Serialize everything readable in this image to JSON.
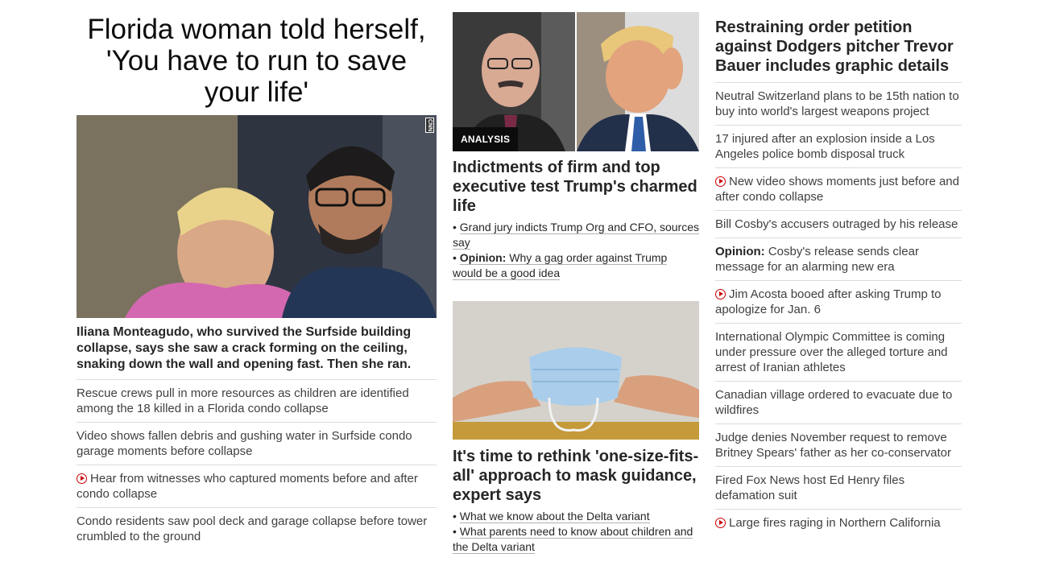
{
  "lead": {
    "headline": "Florida woman told herself, 'You have to run to save your life'",
    "image_badge": "CNN",
    "caption": "Iliana Monteagudo, who survived the Surfside building collapse, says she saw a crack forming on the ceiling, snaking down the wall and opening fast. Then she ran.",
    "related": [
      {
        "text": "Rescue crews pull in more resources as children are identified among the 18 killed in a Florida condo collapse",
        "video": false
      },
      {
        "text": "Video shows fallen debris and gushing water in Surfside condo garage moments before collapse",
        "video": false
      },
      {
        "text": "Hear from witnesses who captured moments before and after condo collapse",
        "video": true
      },
      {
        "text": "Condo residents saw pool deck and garage collapse before tower crumbled to the ground",
        "video": false
      }
    ]
  },
  "middle": {
    "story1": {
      "tag": "ANALYSIS",
      "title": "Indictments of firm and top executive test Trump's charmed life",
      "links": [
        {
          "label": "",
          "text": "Grand jury indicts Trump Org and CFO, sources say"
        },
        {
          "label": "Opinion:",
          "text": "Why a gag order against Trump would be a good idea"
        }
      ]
    },
    "story2": {
      "title": "It's time to rethink 'one-size-fits-all' approach to mask guidance, expert says",
      "links": [
        {
          "label": "",
          "text": "What we know about the Delta variant"
        },
        {
          "label": "",
          "text": "What parents need to know about children and the Delta variant"
        }
      ]
    }
  },
  "right": {
    "headline": "Restraining order petition against Dodgers pitcher Trevor Bauer includes graphic details",
    "items": [
      {
        "label": "",
        "text": "Neutral Switzerland plans to be 15th nation to buy into world's largest weapons project",
        "video": false
      },
      {
        "label": "",
        "text": "17 injured after an explosion inside a Los Angeles police bomb disposal truck",
        "video": false
      },
      {
        "label": "",
        "text": "New video shows moments just before and after condo collapse",
        "video": true
      },
      {
        "label": "",
        "text": "Bill Cosby's accusers outraged by his release",
        "video": false
      },
      {
        "label": "Opinion:",
        "text": "Cosby's release sends clear message for an alarming new era",
        "video": false
      },
      {
        "label": "",
        "text": "Jim Acosta booed after asking Trump to apologize for Jan. 6",
        "video": true
      },
      {
        "label": "",
        "text": "International Olympic Committee is coming under pressure over the alleged torture and arrest of Iranian athletes",
        "video": false
      },
      {
        "label": "",
        "text": "Canadian village ordered to evacuate due to wildfires",
        "video": false
      },
      {
        "label": "",
        "text": "Judge denies November request to remove Britney Spears' father as her co-conservator",
        "video": false
      },
      {
        "label": "",
        "text": "Fired Fox News host Ed Henry files defamation suit",
        "video": false
      },
      {
        "label": "",
        "text": "Large fires raging in Northern California",
        "video": true
      }
    ]
  },
  "icons": {
    "video": "play-circle-icon"
  },
  "colors": {
    "accent": "#cc0000",
    "text": "#262626",
    "divider": "#dcdcdc"
  }
}
